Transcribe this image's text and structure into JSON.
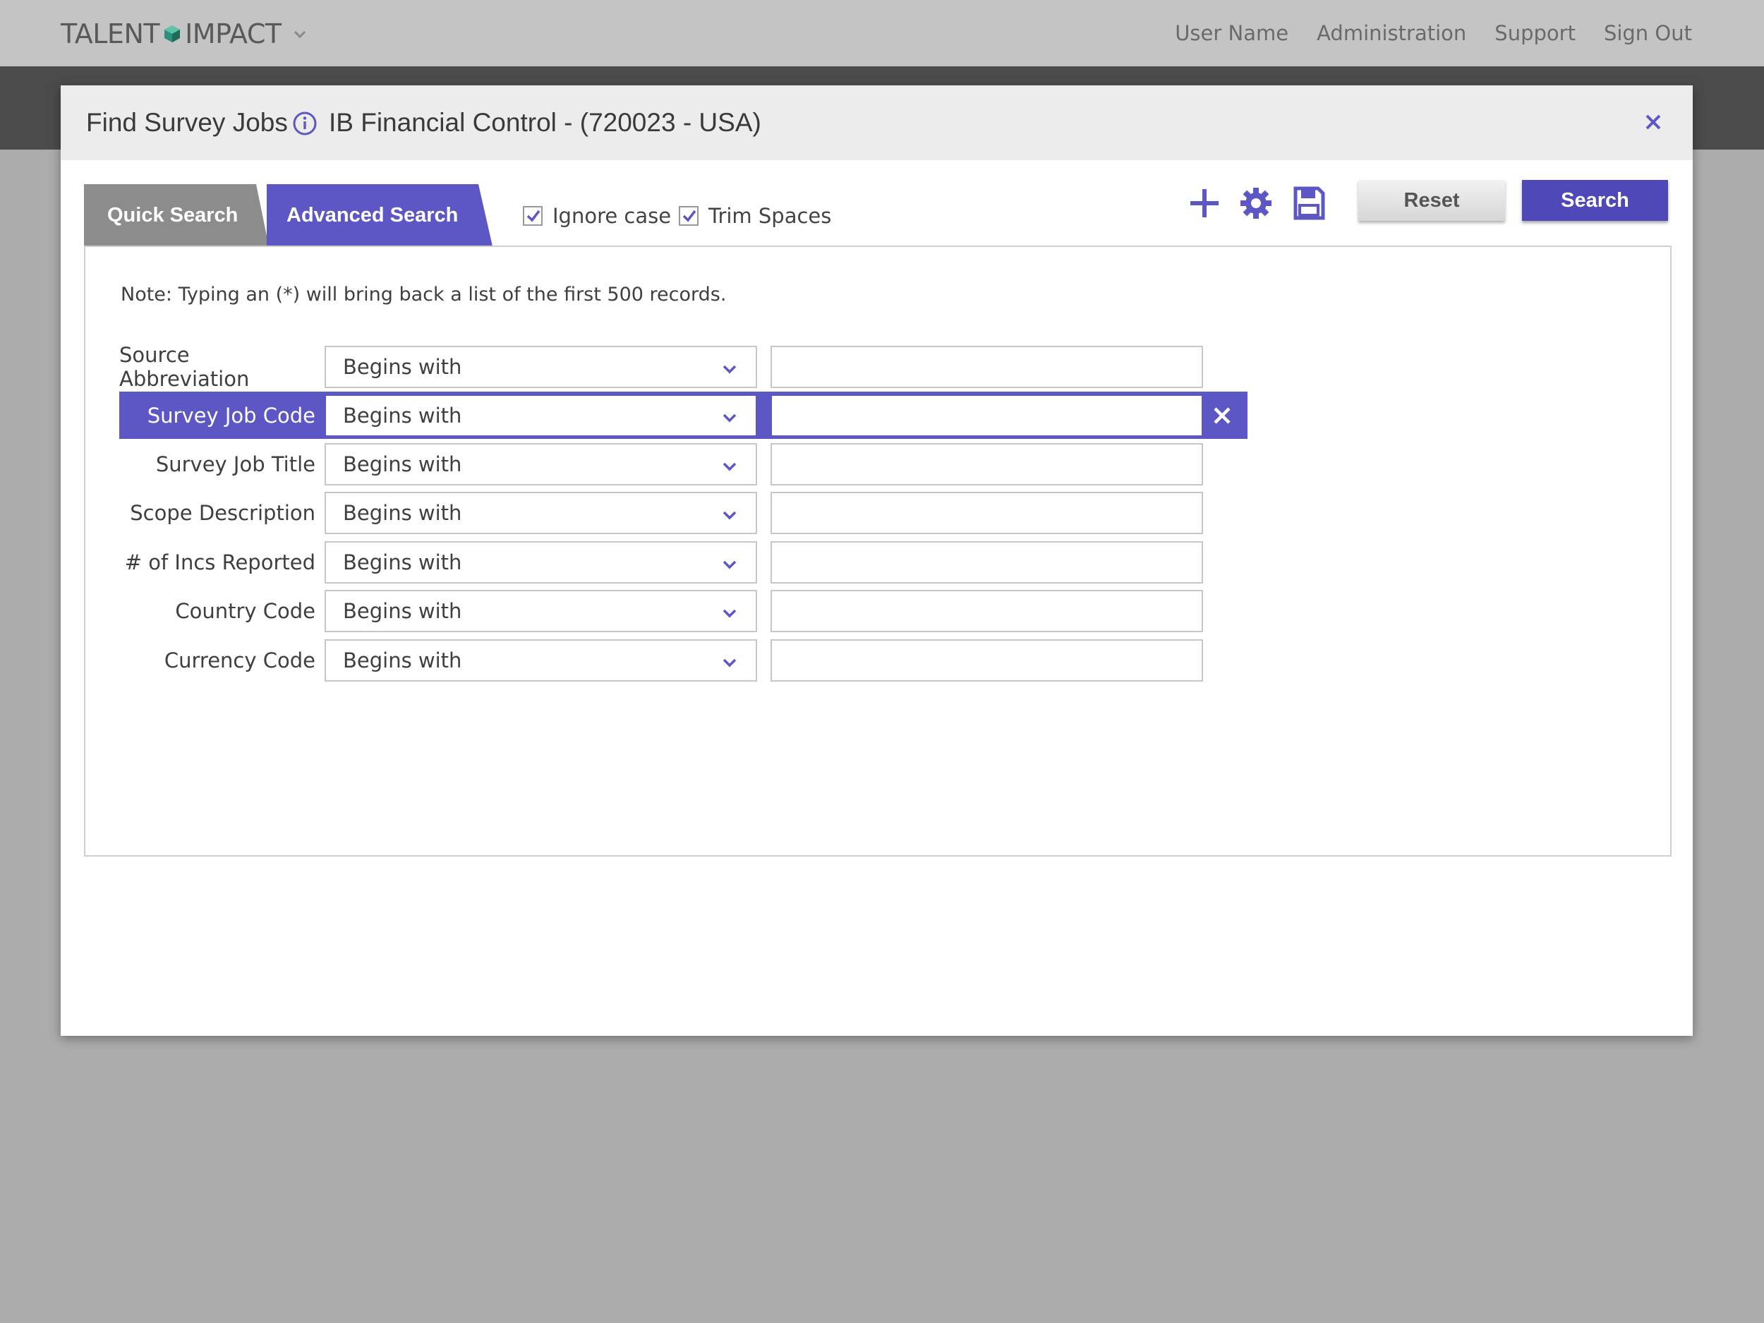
{
  "topbar": {
    "logo_left": "TALENT",
    "logo_right": "IMPACT",
    "nav": {
      "user_name": "User Name",
      "administration": "Administration",
      "support": "Support",
      "sign_out": "Sign Out"
    }
  },
  "modal": {
    "title": "Find Survey Jobs",
    "subtitle": "IB Financial Control - (720023 - USA)",
    "tabs": {
      "quick": "Quick Search",
      "advanced": "Advanced Search",
      "active": "advanced"
    },
    "options": {
      "ignore_case": {
        "label": "Ignore case",
        "checked": true
      },
      "trim_spaces": {
        "label": "Trim Spaces",
        "checked": true
      }
    },
    "buttons": {
      "reset": "Reset",
      "search": "Search"
    },
    "note": "Note: Typing an (*) will bring back a list of the first 500 records.",
    "rows": [
      {
        "label": "Source Abbreviation",
        "operator": "Begins with",
        "value": ""
      },
      {
        "label": "Survey Job Code",
        "operator": "Begins with",
        "value": "",
        "active": true
      },
      {
        "label": "Survey Job Title",
        "operator": "Begins with",
        "value": ""
      },
      {
        "label": "Scope Description",
        "operator": "Begins with",
        "value": ""
      },
      {
        "label": "# of Incs Reported",
        "operator": "Begins with",
        "value": ""
      },
      {
        "label": "Country Code",
        "operator": "Begins with",
        "value": ""
      },
      {
        "label": "Currency Code",
        "operator": "Begins with",
        "value": ""
      }
    ]
  },
  "colors": {
    "accent": "#5d56c5",
    "search_button": "#4e48b8",
    "logo_cube": "#2e8f7a"
  },
  "icons": [
    "chevron-down-icon",
    "info-icon",
    "close-icon",
    "checkmark-icon",
    "plus-icon",
    "gear-icon",
    "save-icon",
    "clear-icon"
  ]
}
